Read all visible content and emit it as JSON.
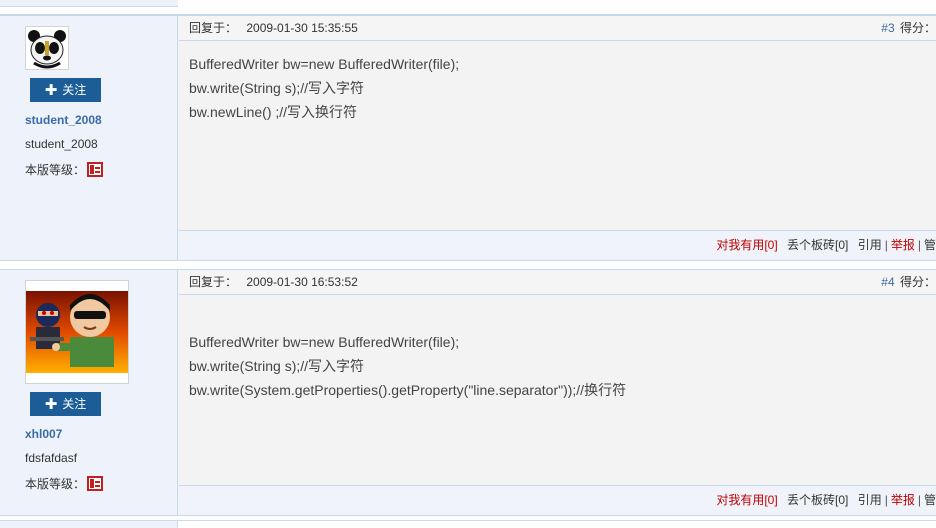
{
  "posts": [
    {
      "username": "student_2008",
      "nickname": "student_2008",
      "follow_label": "关注",
      "level_label": "本版等级：",
      "reply_label": "回复于：",
      "timestamp": "2009-01-30 15:35:55",
      "floor": "#3",
      "score_label": "得分：",
      "content": [
        "BufferedWriter bw=new BufferedWriter(file);",
        "bw.write(String s);//写入字符",
        "bw.newLine() ;//写入换行符"
      ],
      "actions": {
        "useful": "对我有用[0]",
        "brick": "丢个板砖[0]",
        "quote": "引用",
        "report": "举报",
        "manage": "管"
      }
    },
    {
      "username": "xhl007",
      "nickname": "fdsfafdasf",
      "follow_label": "关注",
      "level_label": "本版等级：",
      "reply_label": "回复于：",
      "timestamp": "2009-01-30 16:53:52",
      "floor": "#4",
      "score_label": "得分：",
      "content": [
        "BufferedWriter bw=new BufferedWriter(file);",
        "bw.write(String s);//写入字符",
        "bw.write(System.getProperties().getProperty(\"line.separator\"));//换行符"
      ],
      "actions": {
        "useful": "对我有用[0]",
        "brick": "丢个板砖[0]",
        "quote": "引用",
        "report": "举报",
        "manage": "管"
      }
    }
  ],
  "icons": {
    "follow": "plus-icon",
    "level_badge": "level-badge-icon"
  },
  "colors": {
    "accent": "#1d5d97",
    "username": "#3b6aa6",
    "useful": "#c00000",
    "sidebar_bg": "#eef3fb",
    "border": "#c9d9ec"
  }
}
